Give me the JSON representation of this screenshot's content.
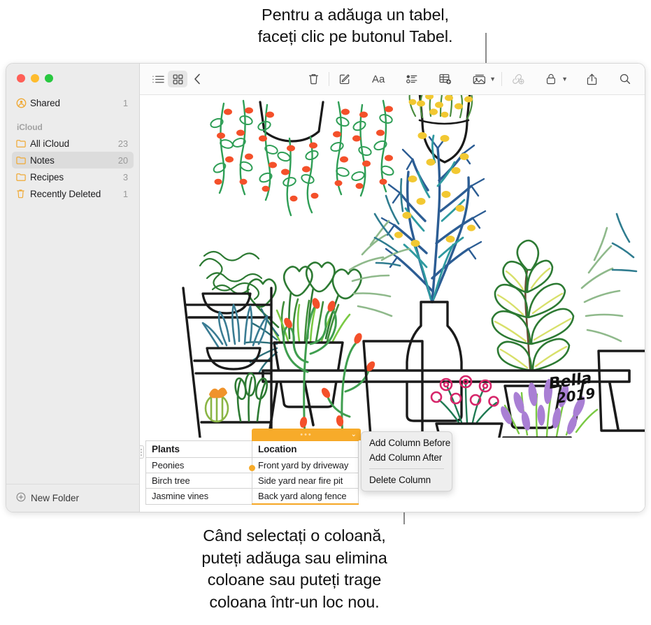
{
  "callouts": {
    "top": "Pentru a adăuga un tabel,\nfaceți clic pe butonul Tabel.",
    "bottom": "Când selectați o coloană,\nputeți adăuga sau elimina\ncoloane sau puteți trage\ncoloana într-un loc nou."
  },
  "window": {
    "traffic_lights": [
      "close",
      "minimize",
      "zoom"
    ]
  },
  "sidebar": {
    "shared": {
      "label": "Shared",
      "count": "1",
      "icon": "shared-person-icon"
    },
    "section_header": "iCloud",
    "items": [
      {
        "label": "All iCloud",
        "count": "23",
        "icon": "folder-icon",
        "selected": false
      },
      {
        "label": "Notes",
        "count": "20",
        "icon": "folder-icon",
        "selected": true
      },
      {
        "label": "Recipes",
        "count": "3",
        "icon": "folder-icon",
        "selected": false
      },
      {
        "label": "Recently Deleted",
        "count": "1",
        "icon": "trash-icon",
        "selected": false
      }
    ],
    "new_folder": {
      "label": "New Folder",
      "icon": "plus-circle-icon"
    }
  },
  "toolbar": {
    "left": [
      {
        "name": "list-view-icon",
        "tip": "List View"
      },
      {
        "name": "gallery-view-icon",
        "tip": "Gallery View"
      },
      {
        "name": "back-chevron-icon",
        "tip": "Back"
      }
    ],
    "right": [
      {
        "name": "trash-icon",
        "tip": "Delete"
      },
      {
        "name": "compose-icon",
        "tip": "New Note"
      },
      {
        "name": "format-aa-icon",
        "tip": "Format",
        "label": "Aa"
      },
      {
        "name": "checklist-icon",
        "tip": "Checklist"
      },
      {
        "name": "table-icon",
        "tip": "Table"
      },
      {
        "name": "media-icon",
        "tip": "Media"
      },
      {
        "name": "link-icon",
        "tip": "Link",
        "disabled": true
      },
      {
        "name": "lock-icon",
        "tip": "Lock"
      },
      {
        "name": "share-icon",
        "tip": "Share"
      },
      {
        "name": "search-icon",
        "tip": "Search"
      }
    ]
  },
  "note": {
    "illustration": {
      "name": "potted-plants-drawing",
      "signature": "Bella 2019"
    },
    "table": {
      "headers": [
        "Plants",
        "Location"
      ],
      "rows": [
        [
          "Peonies",
          "Front yard by driveway"
        ],
        [
          "Birch tree",
          "Side yard near fire pit"
        ],
        [
          "Jasmine vines",
          "Back yard along fence"
        ]
      ],
      "selected_column_index": 1,
      "selection_color": "#f7ab2a"
    }
  },
  "context_menu": {
    "items": [
      {
        "label": "Add Column Before"
      },
      {
        "label": "Add Column After"
      },
      {
        "label": "Delete Column"
      }
    ]
  }
}
